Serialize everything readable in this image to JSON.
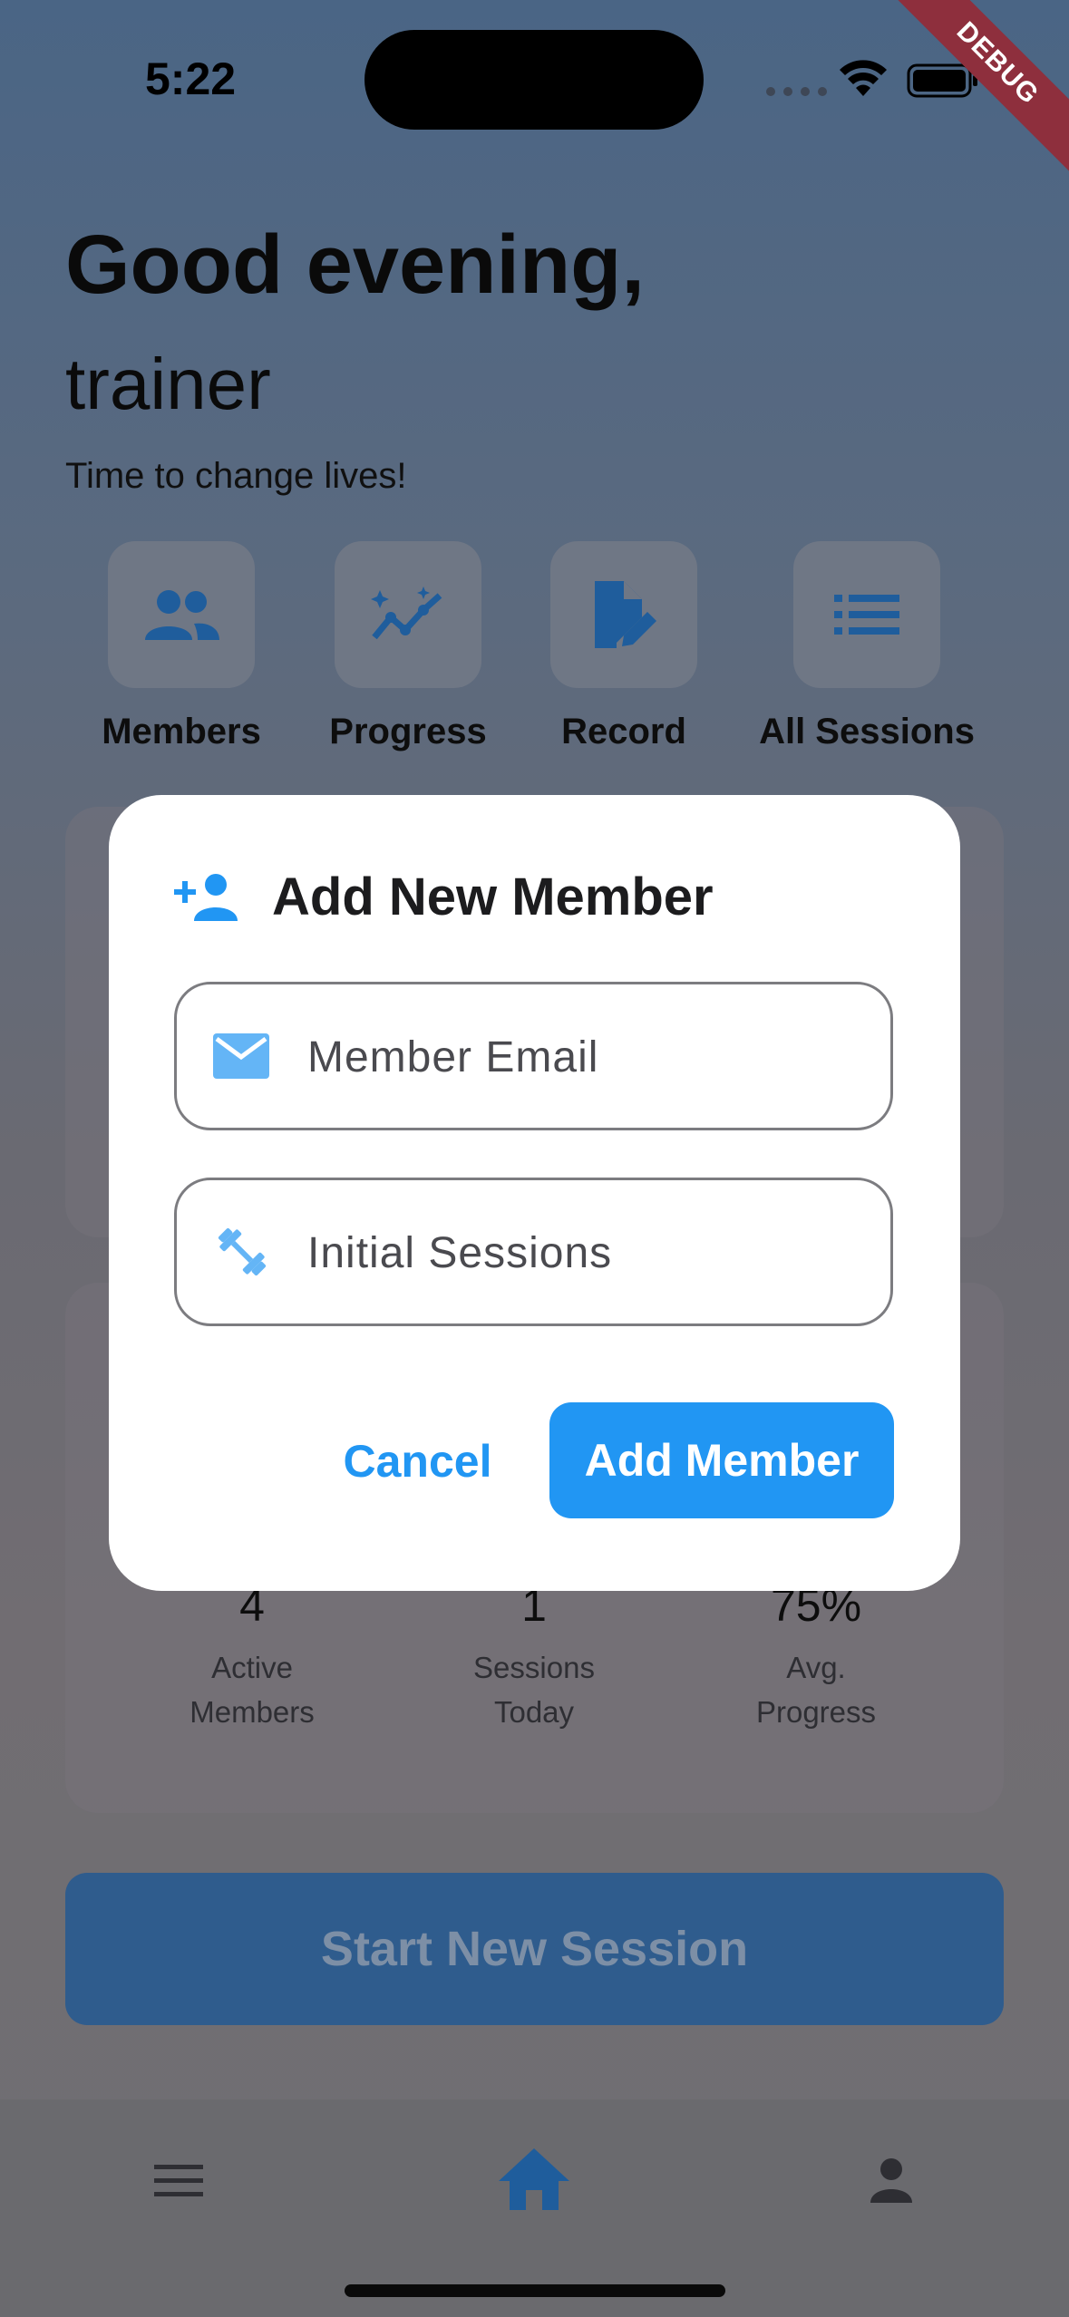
{
  "status_bar": {
    "time": "5:22",
    "debug_label": "DEBUG"
  },
  "header": {
    "greeting": "Good evening,",
    "name": "trainer",
    "tagline": "Time to change lives!"
  },
  "quick_actions": [
    {
      "label": "Members",
      "icon": "group-icon"
    },
    {
      "label": "Progress",
      "icon": "trending-sparkle-icon"
    },
    {
      "label": "Record",
      "icon": "edit-document-icon"
    },
    {
      "label": "All Sessions",
      "icon": "list-icon"
    }
  ],
  "stats": [
    {
      "value": "4",
      "label_line1": "Active",
      "label_line2": "Members"
    },
    {
      "value": "1",
      "label_line1": "Sessions",
      "label_line2": "Today"
    },
    {
      "value": "75%",
      "label_line1": "Avg.",
      "label_line2": "Progress"
    }
  ],
  "start_session_label": "Start New Session",
  "bottom_nav": [
    {
      "icon": "menu-icon"
    },
    {
      "icon": "home-icon",
      "active": true
    },
    {
      "icon": "person-icon"
    }
  ],
  "dialog": {
    "title": "Add New Member",
    "email_placeholder": "Member Email",
    "sessions_placeholder": "Initial Sessions",
    "cancel_label": "Cancel",
    "confirm_label": "Add Member"
  },
  "colors": {
    "accent": "#2196f3",
    "dialog_bg": "#ffffff"
  }
}
